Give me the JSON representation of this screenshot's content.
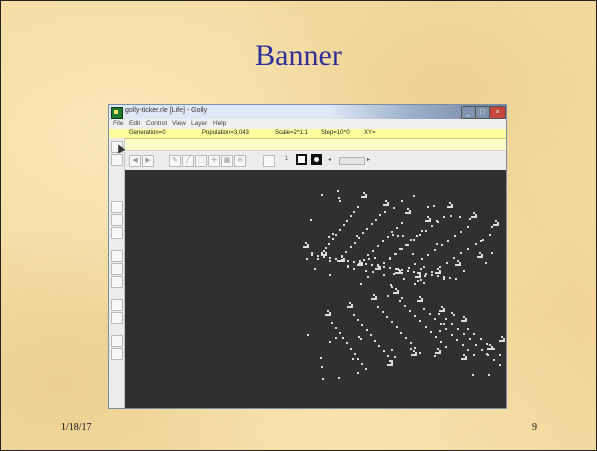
{
  "slide": {
    "title": "Banner",
    "date": "1/18/17",
    "page_number": "9"
  },
  "app": {
    "window_title": "golly-ticker.rle [Life] - Golly",
    "title_buttons": [
      "_",
      "□",
      "×"
    ],
    "menu": [
      "File",
      "Edit",
      "Control",
      "View",
      "Layer",
      "Help"
    ],
    "info": {
      "generation": "Generation=0",
      "population": "Population=3,043",
      "scale": "Scale=2^1:1",
      "step": "Step=10^0",
      "xy": "XY="
    },
    "toolbar": {
      "buttons": [
        {
          "name": "back-icon",
          "glyph": "◀"
        },
        {
          "name": "forward-icon",
          "glyph": "▶"
        },
        {
          "name": "pencil-icon",
          "glyph": "✎"
        },
        {
          "name": "pick-icon",
          "glyph": "╱"
        },
        {
          "name": "select-icon",
          "glyph": "⬚"
        },
        {
          "name": "move-icon",
          "glyph": "✛"
        },
        {
          "name": "zoom-in-icon",
          "glyph": "▦"
        },
        {
          "name": "zoom-out-icon",
          "glyph": "⊖"
        }
      ],
      "state_label": "1",
      "arrow_left": "◂",
      "arrow_right": "▸"
    },
    "colors": {
      "info_bar": "#ffff9e",
      "canvas": "#303030",
      "cell": "#dcdcdc"
    }
  }
}
